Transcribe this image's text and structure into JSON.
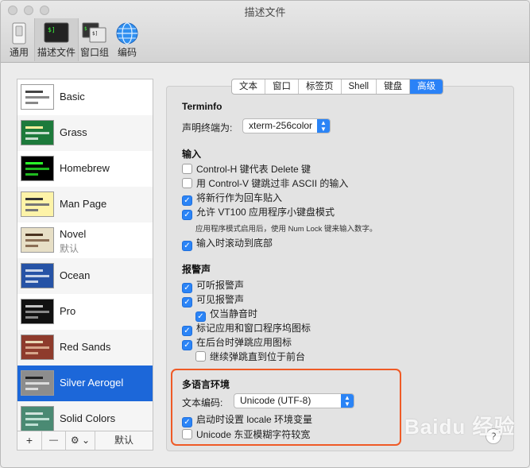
{
  "window": {
    "title": "描述文件"
  },
  "toolbar": [
    {
      "label": "通用",
      "icon": "switch-icon"
    },
    {
      "label": "描述文件",
      "icon": "terminal-profile-icon",
      "active": true
    },
    {
      "label": "窗口组",
      "icon": "window-group-icon"
    },
    {
      "label": "编码",
      "icon": "globe-icon"
    }
  ],
  "profiles": [
    {
      "name": "Basic",
      "colors": [
        "#ffffff",
        "#222222"
      ]
    },
    {
      "name": "Grass",
      "colors": [
        "#1d7a3b",
        "#ffef9c"
      ]
    },
    {
      "name": "Homebrew",
      "colors": [
        "#000000",
        "#2aff2a"
      ]
    },
    {
      "name": "Man Page",
      "colors": [
        "#fdf3a8",
        "#111111"
      ]
    },
    {
      "name": "Novel",
      "sub": "默认",
      "colors": [
        "#e7dfc6",
        "#4a3320"
      ]
    },
    {
      "name": "Ocean",
      "colors": [
        "#2653a6",
        "#ffffff"
      ]
    },
    {
      "name": "Pro",
      "colors": [
        "#111111",
        "#f0f0f0"
      ]
    },
    {
      "name": "Red Sands",
      "colors": [
        "#8e3b2c",
        "#e8d8b4"
      ]
    },
    {
      "name": "Silver Aerogel",
      "colors": [
        "#8d8d8d",
        "#111111"
      ],
      "selected": true
    },
    {
      "name": "Solid Colors",
      "colors": [
        "#4a8a73",
        "#ffffff"
      ]
    }
  ],
  "list_buttons": {
    "add": "+",
    "remove": "—",
    "gear": "⚙ ⌄",
    "default": "默认"
  },
  "tabs": [
    {
      "label": "文本"
    },
    {
      "label": "窗口"
    },
    {
      "label": "标签页"
    },
    {
      "label": "Shell"
    },
    {
      "label": "键盘"
    },
    {
      "label": "高级",
      "active": true
    }
  ],
  "terminfo": {
    "heading": "Terminfo",
    "declare_label": "声明终端为:",
    "declare_value": "xterm-256color"
  },
  "input": {
    "heading": "输入",
    "options": [
      {
        "label": "Control-H 键代表 Delete 键",
        "checked": false
      },
      {
        "label": "用 Control-V 键跳过非 ASCII 的输入",
        "checked": false
      },
      {
        "label": "将新行作为回车贴入",
        "checked": true
      },
      {
        "label": "允许 VT100 应用程序小键盘模式",
        "checked": true
      }
    ],
    "note": "应用程序模式启用后，使用 Num Lock 键来输入数字。",
    "scroll_option": {
      "label": "输入时滚动到底部",
      "checked": true
    }
  },
  "bell": {
    "heading": "报警声",
    "options": [
      {
        "label": "可听报警声",
        "checked": true
      },
      {
        "label": "可见报警声",
        "checked": true
      },
      {
        "label": "仅当静音时",
        "checked": true,
        "indent": true
      },
      {
        "label": "标记应用和窗口程序坞图标",
        "checked": true
      },
      {
        "label": "在后台时弹跳应用图标",
        "checked": true
      },
      {
        "label": "继续弹跳直到位于前台",
        "checked": false,
        "indent": true
      }
    ]
  },
  "international": {
    "heading": "多语言环境",
    "encoding_label": "文本编码:",
    "encoding_value": "Unicode (UTF-8)",
    "options": [
      {
        "label": "启动时设置 locale 环境变量",
        "checked": true
      },
      {
        "label": "Unicode 东亚模糊字符较宽",
        "checked": false
      }
    ]
  },
  "help_label": "?",
  "watermark": "Baidu 经验"
}
